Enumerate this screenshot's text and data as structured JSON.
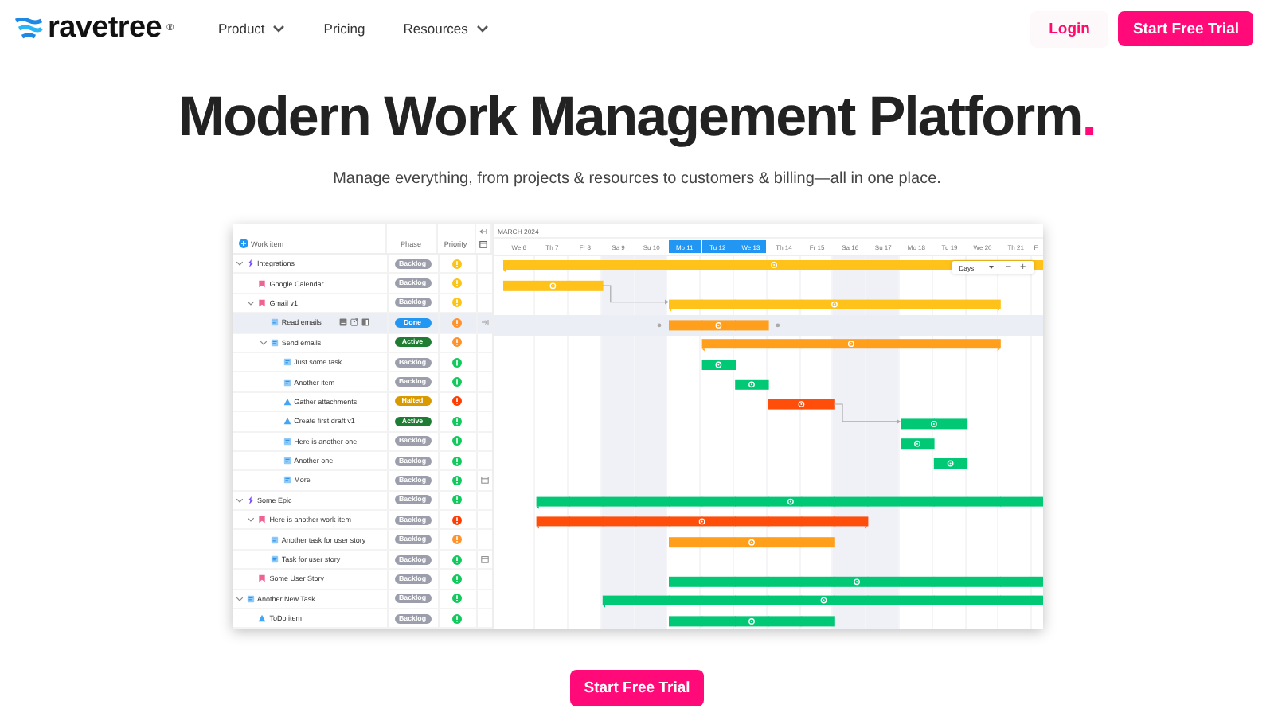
{
  "header": {
    "brand": "ravetree",
    "brand_mark": "®",
    "nav": [
      {
        "label": "Product",
        "dropdown": true
      },
      {
        "label": "Pricing",
        "dropdown": false
      },
      {
        "label": "Resources",
        "dropdown": true
      }
    ],
    "login": "Login",
    "cta": "Start Free Trial"
  },
  "hero": {
    "title": "Modern Work Management Platform",
    "title_accent": ".",
    "subtitle": "Manage everything, from projects & resources to customers & billing—all in one place."
  },
  "gantt": {
    "columns": [
      "Work item",
      "Phase",
      "Priority"
    ],
    "month": "MARCH 2024",
    "days": [
      {
        "label": "We 6",
        "weekend": false,
        "highlighted": false
      },
      {
        "label": "Th 7",
        "weekend": false,
        "highlighted": false
      },
      {
        "label": "Fr 8",
        "weekend": false,
        "highlighted": false
      },
      {
        "label": "Sa 9",
        "weekend": true,
        "highlighted": false
      },
      {
        "label": "Su 10",
        "weekend": true,
        "highlighted": false
      },
      {
        "label": "Mo 11",
        "weekend": false,
        "highlighted": true
      },
      {
        "label": "Tu 12",
        "weekend": false,
        "highlighted": true
      },
      {
        "label": "We 13",
        "weekend": false,
        "highlighted": true
      },
      {
        "label": "Th 14",
        "weekend": false,
        "highlighted": false
      },
      {
        "label": "Fr 15",
        "weekend": false,
        "highlighted": false
      },
      {
        "label": "Sa 16",
        "weekend": true,
        "highlighted": false
      },
      {
        "label": "Su 17",
        "weekend": true,
        "highlighted": false
      },
      {
        "label": "Mo 18",
        "weekend": false,
        "highlighted": false
      },
      {
        "label": "Tu 19",
        "weekend": false,
        "highlighted": false
      },
      {
        "label": "We 20",
        "weekend": false,
        "highlighted": false
      },
      {
        "label": "Th 21",
        "weekend": false,
        "highlighted": false
      },
      {
        "label": "F",
        "weekend": false,
        "highlighted": false
      }
    ],
    "scale": {
      "value": "Days",
      "zoom_out": "−",
      "zoom_in": "+"
    },
    "rows": [
      {
        "name": "Integrations",
        "kind": "epic",
        "expanded": true,
        "selected": false,
        "phase": {
          "label": "Backlog",
          "color": "#9c9eab"
        },
        "priority": {
          "color": "#fcc419"
        },
        "bar": {
          "color": "#ffc21a",
          "summary": true,
          "days": [
            true,
            true,
            true,
            true,
            true,
            true,
            true,
            true,
            true,
            true,
            true,
            true,
            true,
            true,
            true,
            true,
            true
          ]
        },
        "children": [
          {
            "name": "Google Calendar",
            "kind": "story",
            "selected": false,
            "phase": {
              "label": "Backlog",
              "color": "#9c9eab"
            },
            "priority": {
              "color": "#fcc419"
            },
            "bar": {
              "color": "#ffc21a",
              "summary": false,
              "days": [
                true,
                true,
                true,
                false,
                false,
                false,
                false,
                false,
                false,
                false,
                false,
                false,
                false,
                false,
                false,
                false,
                false
              ]
            }
          },
          {
            "name": "Gmail v1",
            "kind": "story",
            "expanded": true,
            "selected": false,
            "depends_on_previous": true,
            "phase": {
              "label": "Backlog",
              "color": "#9c9eab"
            },
            "priority": {
              "color": "#fcc419"
            },
            "bar": {
              "color": "#ffc21a",
              "summary": true,
              "days": [
                false,
                false,
                false,
                false,
                false,
                true,
                true,
                true,
                true,
                true,
                true,
                true,
                true,
                true,
                true,
                false,
                false
              ]
            },
            "children": [
              {
                "name": "Read emails",
                "kind": "task",
                "selected": true,
                "show_actions": true,
                "marker": {
                  "kind": "arrow"
                },
                "phase": {
                  "label": "Done",
                  "color": "#2196f3"
                },
                "priority": {
                  "color": "#ff922b"
                },
                "bar": {
                  "color": "#ff9f1c",
                  "summary": false,
                  "days": [
                    false,
                    false,
                    false,
                    false,
                    false,
                    true,
                    true,
                    true,
                    false,
                    false,
                    false,
                    false,
                    false,
                    false,
                    false,
                    false,
                    false
                  ]
                }
              },
              {
                "name": "Send emails",
                "kind": "task",
                "expanded": true,
                "selected": false,
                "phase": {
                  "label": "Active",
                  "color": "#1e7d32"
                },
                "priority": {
                  "color": "#ff922b"
                },
                "bar": {
                  "color": "#ff9f1c",
                  "summary": true,
                  "days": [
                    false,
                    false,
                    false,
                    false,
                    false,
                    false,
                    true,
                    true,
                    true,
                    true,
                    true,
                    true,
                    true,
                    true,
                    true,
                    false,
                    false
                  ]
                },
                "children": [
                  {
                    "name": "Just some task",
                    "kind": "task",
                    "selected": false,
                    "phase": {
                      "label": "Backlog",
                      "color": "#9c9eab"
                    },
                    "priority": {
                      "color": "#12c95e"
                    },
                    "bar": {
                      "color": "#00c875",
                      "summary": false,
                      "days": [
                        false,
                        false,
                        false,
                        false,
                        false,
                        false,
                        true,
                        false,
                        false,
                        false,
                        false,
                        false,
                        false,
                        false,
                        false,
                        false,
                        false
                      ]
                    }
                  },
                  {
                    "name": "Another item",
                    "kind": "task",
                    "selected": false,
                    "phase": {
                      "label": "Backlog",
                      "color": "#9c9eab"
                    },
                    "priority": {
                      "color": "#12c95e"
                    },
                    "bar": {
                      "color": "#00c875",
                      "summary": false,
                      "days": [
                        false,
                        false,
                        false,
                        false,
                        false,
                        false,
                        false,
                        true,
                        false,
                        false,
                        false,
                        false,
                        false,
                        false,
                        false,
                        false,
                        false
                      ]
                    }
                  },
                  {
                    "name": "Gather attachments",
                    "kind": "subtask",
                    "selected": false,
                    "phase": {
                      "label": "Halted",
                      "color": "#d99a00"
                    },
                    "priority": {
                      "color": "#ff3d00"
                    },
                    "bar": {
                      "color": "#ff4d0a",
                      "summary": false,
                      "days": [
                        false,
                        false,
                        false,
                        false,
                        false,
                        false,
                        false,
                        false,
                        true,
                        true,
                        false,
                        false,
                        false,
                        false,
                        false,
                        false,
                        false
                      ]
                    }
                  },
                  {
                    "name": "Create first draft v1",
                    "kind": "subtask",
                    "selected": false,
                    "depends_on_previous": true,
                    "phase": {
                      "label": "Active",
                      "color": "#1e7d32"
                    },
                    "priority": {
                      "color": "#12c95e"
                    },
                    "bar": {
                      "color": "#00c875",
                      "summary": false,
                      "days": [
                        false,
                        false,
                        false,
                        false,
                        false,
                        false,
                        false,
                        false,
                        false,
                        false,
                        false,
                        false,
                        true,
                        true,
                        false,
                        false,
                        false
                      ]
                    }
                  },
                  {
                    "name": "Here is another one",
                    "kind": "task",
                    "selected": false,
                    "phase": {
                      "label": "Backlog",
                      "color": "#9c9eab"
                    },
                    "priority": {
                      "color": "#12c95e"
                    },
                    "bar": {
                      "color": "#00c875",
                      "summary": false,
                      "days": [
                        false,
                        false,
                        false,
                        false,
                        false,
                        false,
                        false,
                        false,
                        false,
                        false,
                        false,
                        false,
                        true,
                        false,
                        false,
                        false,
                        false
                      ]
                    }
                  },
                  {
                    "name": "Another one",
                    "kind": "task",
                    "selected": false,
                    "phase": {
                      "label": "Backlog",
                      "color": "#9c9eab"
                    },
                    "priority": {
                      "color": "#12c95e"
                    },
                    "bar": {
                      "color": "#00c875",
                      "summary": false,
                      "days": [
                        false,
                        false,
                        false,
                        false,
                        false,
                        false,
                        false,
                        false,
                        false,
                        false,
                        false,
                        false,
                        false,
                        true,
                        false,
                        false,
                        false
                      ]
                    }
                  },
                  {
                    "name": "More",
                    "kind": "task",
                    "selected": false,
                    "marker": {
                      "kind": "calendar"
                    },
                    "phase": {
                      "label": "Backlog",
                      "color": "#9c9eab"
                    },
                    "priority": {
                      "color": "#12c95e"
                    }
                  }
                ]
              }
            ]
          }
        ]
      },
      {
        "name": "Some Epic",
        "kind": "epic",
        "expanded": true,
        "selected": false,
        "phase": {
          "label": "Backlog",
          "color": "#9c9eab"
        },
        "priority": {
          "color": "#12c95e"
        },
        "bar": {
          "color": "#00c875",
          "summary": true,
          "days": [
            false,
            true,
            true,
            true,
            true,
            true,
            true,
            true,
            true,
            true,
            true,
            true,
            true,
            true,
            true,
            true,
            true
          ]
        },
        "children": [
          {
            "name": "Here is another work item",
            "kind": "story",
            "expanded": true,
            "selected": false,
            "phase": {
              "label": "Backlog",
              "color": "#9c9eab"
            },
            "priority": {
              "color": "#ff3d00"
            },
            "bar": {
              "color": "#ff4d0a",
              "summary": true,
              "days": [
                false,
                true,
                true,
                true,
                true,
                true,
                true,
                true,
                true,
                true,
                true,
                false,
                false,
                false,
                false,
                false,
                false
              ]
            },
            "children": [
              {
                "name": "Another task for user story",
                "kind": "task",
                "selected": false,
                "phase": {
                  "label": "Backlog",
                  "color": "#9c9eab"
                },
                "priority": {
                  "color": "#ff922b"
                },
                "bar": {
                  "color": "#ff9f1c",
                  "summary": false,
                  "days": [
                    false,
                    false,
                    false,
                    false,
                    false,
                    true,
                    true,
                    true,
                    true,
                    true,
                    false,
                    false,
                    false,
                    false,
                    false,
                    false,
                    false
                  ]
                }
              },
              {
                "name": "Task for user story",
                "kind": "task",
                "selected": false,
                "marker": {
                  "kind": "calendar"
                },
                "phase": {
                  "label": "Backlog",
                  "color": "#9c9eab"
                },
                "priority": {
                  "color": "#12c95e"
                }
              }
            ]
          },
          {
            "name": "Some User Story",
            "kind": "story",
            "selected": false,
            "phase": {
              "label": "Backlog",
              "color": "#9c9eab"
            },
            "priority": {
              "color": "#12c95e"
            },
            "bar": {
              "color": "#00c875",
              "summary": false,
              "days": [
                false,
                false,
                false,
                false,
                false,
                true,
                true,
                true,
                true,
                true,
                true,
                true,
                true,
                true,
                true,
                true,
                true
              ]
            }
          }
        ]
      },
      {
        "name": "Another New Task",
        "kind": "task",
        "expanded": true,
        "selected": false,
        "phase": {
          "label": "Backlog",
          "color": "#9c9eab"
        },
        "priority": {
          "color": "#12c95e"
        },
        "bar": {
          "color": "#00c875",
          "summary": true,
          "days": [
            false,
            false,
            false,
            true,
            true,
            true,
            true,
            true,
            true,
            true,
            true,
            true,
            true,
            true,
            true,
            true,
            true
          ]
        },
        "children": [
          {
            "name": "ToDo item",
            "kind": "subtask",
            "selected": false,
            "phase": {
              "label": "Backlog",
              "color": "#9c9eab"
            },
            "priority": {
              "color": "#12c95e"
            },
            "bar": {
              "color": "#00c875",
              "summary": false,
              "days": [
                false,
                false,
                false,
                false,
                false,
                true,
                true,
                true,
                true,
                true,
                false,
                false,
                false,
                false,
                false,
                false,
                false
              ]
            }
          }
        ]
      }
    ]
  },
  "footer_cta": "Start Free Trial"
}
